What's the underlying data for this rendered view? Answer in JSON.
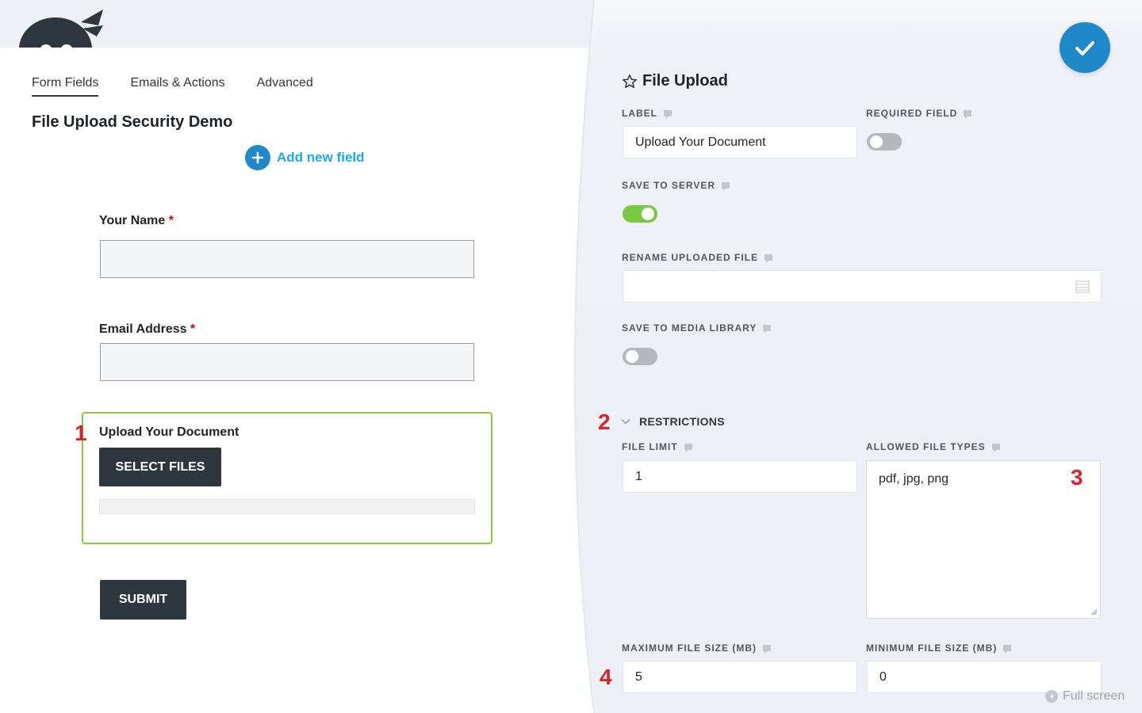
{
  "tabs": [
    "Form Fields",
    "Emails & Actions",
    "Advanced"
  ],
  "form": {
    "title": "File Upload Security Demo",
    "add_field_label": "Add new field",
    "name_label": "Your Name",
    "email_label": "Email Address",
    "required_mark": "*",
    "upload_label": "Upload Your Document",
    "select_files_label": "SELECT FILES",
    "submit_label": "SUBMIT"
  },
  "markers": [
    "1",
    "2",
    "3",
    "4"
  ],
  "panel": {
    "title": "File Upload",
    "label_label": "LABEL",
    "label_value": "Upload Your Document",
    "required_label": "REQUIRED FIELD",
    "required_on": false,
    "save_server_label": "SAVE TO SERVER",
    "save_server_on": true,
    "rename_label": "RENAME UPLOADED FILE",
    "rename_value": "",
    "media_label": "SAVE TO MEDIA LIBRARY",
    "media_on": false,
    "restrictions_label": "RESTRICTIONS",
    "file_limit_label": "FILE LIMIT",
    "file_limit_value": "1",
    "allowed_types_label": "ALLOWED FILE TYPES",
    "allowed_types_value": "pdf, jpg, png",
    "max_size_label": "MAXIMUM FILE SIZE (MB)",
    "max_size_value": "5",
    "min_size_label": "MINIMUM FILE SIZE (MB)",
    "min_size_value": "0"
  },
  "fullscreen_label": "Full screen",
  "colors": {
    "accent": "#1e88c9",
    "link": "#1ea9ea",
    "toggle_on": "#7ac943",
    "selected_border": "#8dc63f",
    "marker": "#d8232a",
    "dark_button": "#2e3640"
  }
}
